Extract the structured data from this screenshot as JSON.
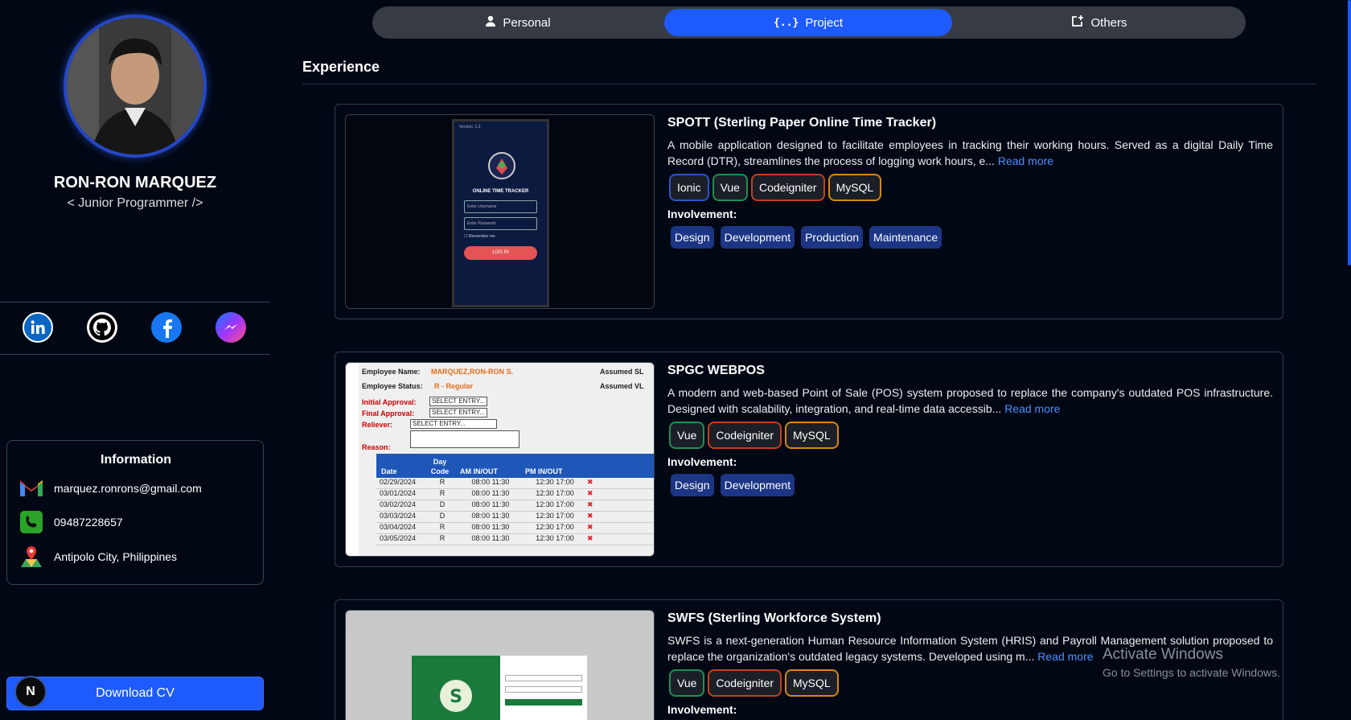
{
  "profile": {
    "name": "RON-RON MARQUEZ",
    "role": "< Junior Programmer />"
  },
  "socials": [
    {
      "icon": "linkedin-icon",
      "color": "#0a66c2"
    },
    {
      "icon": "github-icon",
      "color": "#ffffff"
    },
    {
      "icon": "facebook-icon",
      "color": "#1877f2"
    },
    {
      "icon": "messenger-icon",
      "color": "#a04cff"
    }
  ],
  "information": {
    "title": "Information",
    "email": "marquez.ronrons@gmail.com",
    "phone": "09487228657",
    "location": "Antipolo City, Philippines"
  },
  "download_label": "Download CV",
  "badge_letter": "N",
  "tabs": [
    {
      "label": "Personal",
      "icon": "person-icon",
      "active": false
    },
    {
      "label": "Project",
      "icon": "code-braces-icon",
      "active": true
    },
    {
      "label": "Others",
      "icon": "external-add-icon",
      "active": false
    }
  ],
  "section_title": "Experience",
  "involvement_label": "Involvement:",
  "read_more": "Read more",
  "projects": [
    {
      "title": "SPOTT (Sterling Paper Online Time Tracker)",
      "description": "A mobile application designed to facilitate employees in tracking their working hours. Served as a digital Daily Time Record (DTR), streamlines the process of logging work hours, e...",
      "tech": [
        "Ionic",
        "Vue",
        "Codeigniter",
        "MySQL"
      ],
      "involvement": [
        "Design",
        "Development",
        "Production",
        "Maintenance"
      ],
      "mock": {
        "version": "Version: 1.3",
        "heading": "ONLINE TIME TRACKER",
        "username": "Enter Username",
        "password": "Enter Password",
        "remember": "Remember me",
        "login": "LOG IN"
      }
    },
    {
      "title": "SPGC WEBPOS",
      "description": "A modern and web-based Point of Sale (POS) system proposed to replace the company's outdated POS infrastructure. Designed with scalability, integration, and real-time data accessib...",
      "tech": [
        "Vue",
        "Codeigniter",
        "MySQL"
      ],
      "involvement": [
        "Design",
        "Development"
      ],
      "mock": {
        "emp_name_label": "Employee Name:",
        "emp_name": "MARQUEZ,RON-RON S.",
        "emp_status_label": "Employee Status:",
        "emp_status": "R - Regular",
        "assumed_sl": "Assumed SL",
        "assumed_vl": "Assumed VL",
        "initial": "Initial Approval:",
        "final": "Final Approval:",
        "reliever": "Reliever:",
        "reason": "Reason:",
        "select": "SELECT ENTRY...",
        "headers": [
          "Date",
          "Day Code",
          "AM IN/OUT",
          "PM IN/OUT"
        ],
        "rows": [
          [
            "02/29/2024",
            "R",
            "08:00  11:30",
            "12:30  17:00"
          ],
          [
            "03/01/2024",
            "R",
            "08:00  11:30",
            "12:30  17:00"
          ],
          [
            "03/02/2024",
            "D",
            "08:00  11:30",
            "12:30  17:00"
          ],
          [
            "03/03/2024",
            "D",
            "08:00  11:30",
            "12:30  17:00"
          ],
          [
            "03/04/2024",
            "R",
            "08:00  11:30",
            "12:30  17:00"
          ],
          [
            "03/05/2024",
            "R",
            "08:00  11:30",
            "12:30  17:00"
          ]
        ]
      }
    },
    {
      "title": "SWFS (Sterling Workforce System)",
      "description": "SWFS is a next-generation Human Resource Information System (HRIS) and Payroll Management solution proposed to replace the organization's outdated legacy systems. Developed using m...",
      "tech": [
        "Vue",
        "Codeigniter",
        "MySQL"
      ],
      "involvement": []
    }
  ],
  "watermark": {
    "line1": "Activate Windows",
    "line2": "Go to Settings to activate Windows."
  }
}
